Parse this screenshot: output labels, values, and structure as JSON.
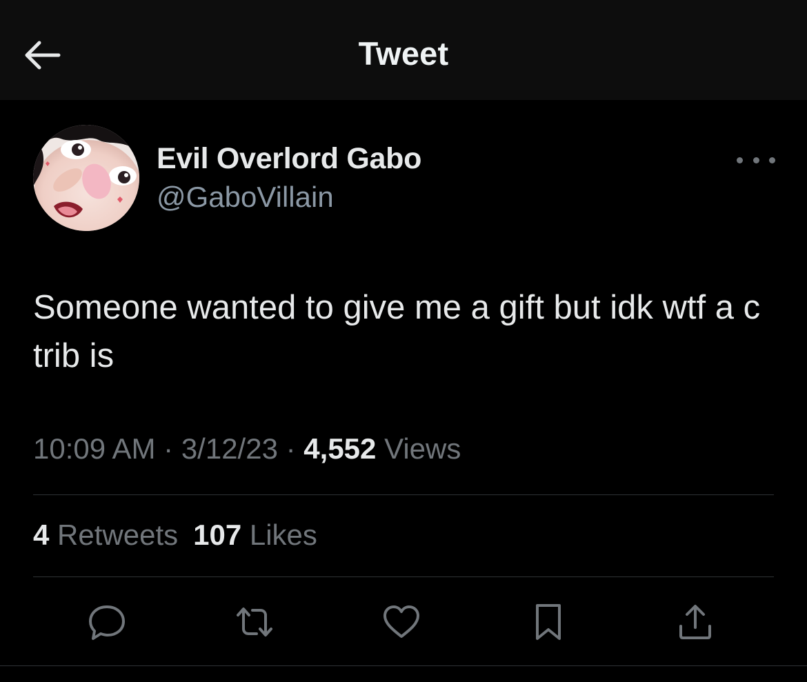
{
  "header": {
    "title": "Tweet",
    "back_icon": "arrow-left-icon"
  },
  "tweet": {
    "author": {
      "display_name": "Evil Overlord Gabo",
      "handle": "@GaboVillain"
    },
    "text": "Someone wanted to give me a gift but idk wtf a c trib is",
    "time": "10:09 AM",
    "separator": "·",
    "date": "3/12/23",
    "views_count": "4,552",
    "views_label": "Views",
    "retweets_count": "4",
    "retweets_label": "Retweets",
    "likes_count": "107",
    "likes_label": "Likes"
  },
  "actions": [
    {
      "name": "reply",
      "icon": "reply-icon"
    },
    {
      "name": "retweet",
      "icon": "retweet-icon"
    },
    {
      "name": "like",
      "icon": "heart-icon"
    },
    {
      "name": "bookmark",
      "icon": "bookmark-icon"
    },
    {
      "name": "share",
      "icon": "share-icon"
    }
  ],
  "colors": {
    "background": "#000000",
    "header_background": "#0d0d0d",
    "primary_text": "#e7e9ea",
    "secondary_text": "#71767b",
    "divider": "#2f3336"
  }
}
